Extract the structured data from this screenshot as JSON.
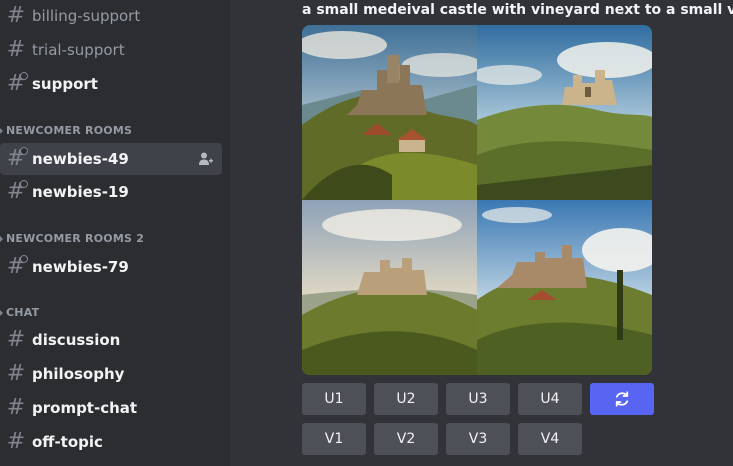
{
  "sidebar": {
    "channels_top": [
      {
        "label": "billing-support"
      },
      {
        "label": "trial-support"
      },
      {
        "label": "support"
      }
    ],
    "categories": [
      {
        "label": "NEWCOMER ROOMS",
        "channels": [
          {
            "label": "newbies-49",
            "active": true
          },
          {
            "label": "newbies-19"
          }
        ]
      },
      {
        "label": "NEWCOMER ROOMS 2",
        "channels": [
          {
            "label": "newbies-79"
          }
        ]
      },
      {
        "label": "CHAT",
        "channels": [
          {
            "label": "discussion"
          },
          {
            "label": "philosophy"
          },
          {
            "label": "prompt-chat"
          },
          {
            "label": "off-topic"
          }
        ]
      }
    ],
    "icons": {
      "channel": "hash-icon",
      "add_member": "add-member-icon"
    }
  },
  "message": {
    "prompt": "a small medeival castle with vineyard next to a small village -"
  },
  "actions": {
    "upscale": [
      "U1",
      "U2",
      "U3",
      "U4"
    ],
    "variation": [
      "V1",
      "V2",
      "V3",
      "V4"
    ],
    "reroll_icon": "refresh-icon"
  },
  "colors": {
    "accent": "#5865f2",
    "button": "#4e5058",
    "sidebar": "#2b2d31",
    "chat": "#313338"
  }
}
